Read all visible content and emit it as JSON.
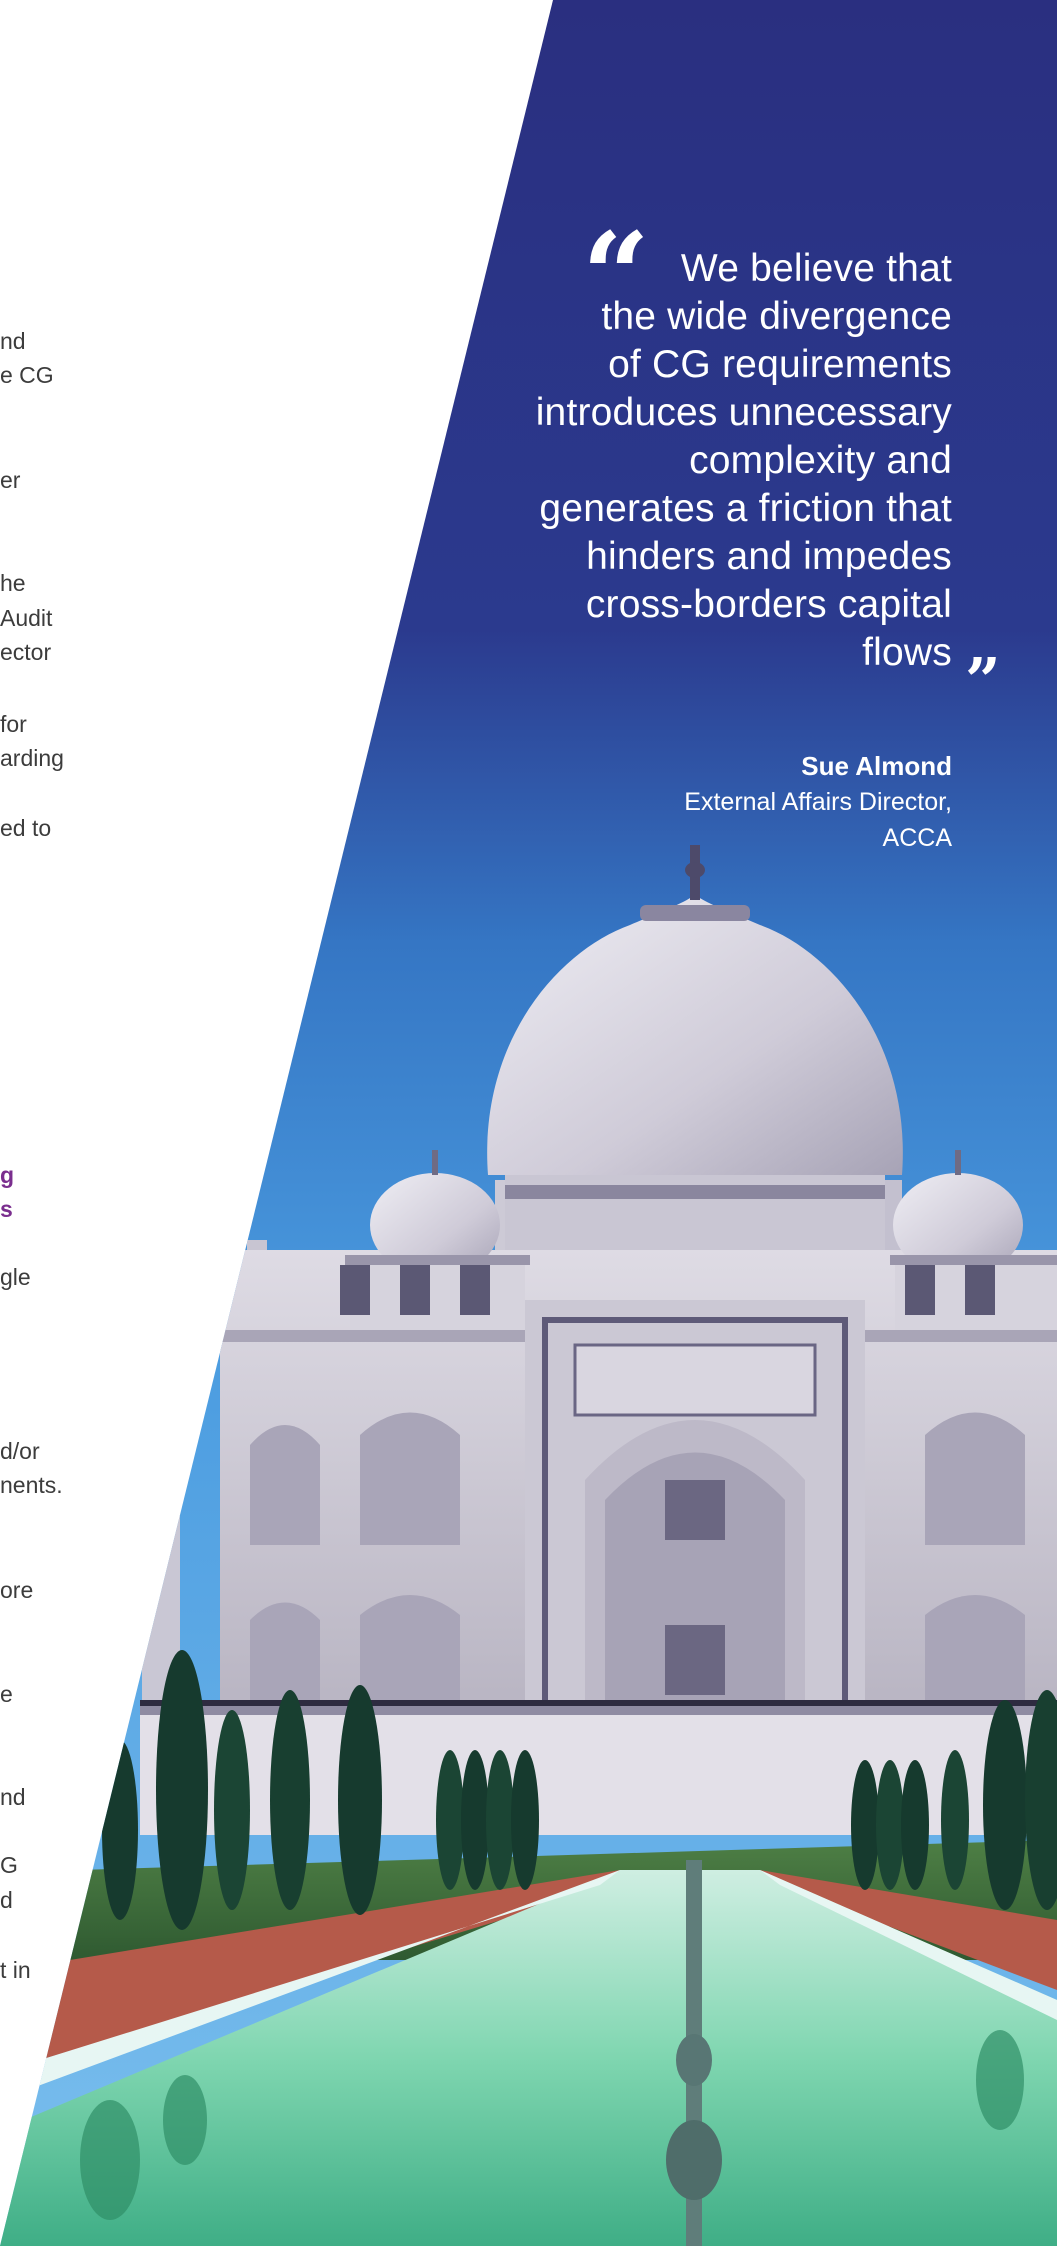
{
  "left_text": [
    "nd",
    "e CG",
    "er",
    "he",
    " Audit",
    "ector",
    "",
    "for",
    "arding",
    "ed to",
    "g",
    "s",
    "gle",
    "d/or",
    "nents.",
    "",
    "ore",
    "",
    "e",
    "nd",
    "G",
    "d",
    "t in"
  ],
  "quote": {
    "open_mark": "“",
    "lines": [
      "We believe that",
      "the wide divergence",
      "of CG requirements",
      "introduces unnecessary",
      "complexity and",
      "generates a friction that",
      "hinders and impedes",
      "cross-borders capital",
      "flows"
    ],
    "close_mark": "”"
  },
  "author": {
    "name": "Sue Almond",
    "role_line1": "External Affairs Director,",
    "role_line2": "ACCA"
  },
  "colors": {
    "navy": "#2a2f80",
    "sky": "#3a86d0",
    "marble": "#d9d6e0",
    "water": "#6ccfa6",
    "cypress": "#163a2e",
    "purple_heading": "#7a2e8e"
  },
  "image": {
    "subject": "taj-mahal-photo"
  }
}
